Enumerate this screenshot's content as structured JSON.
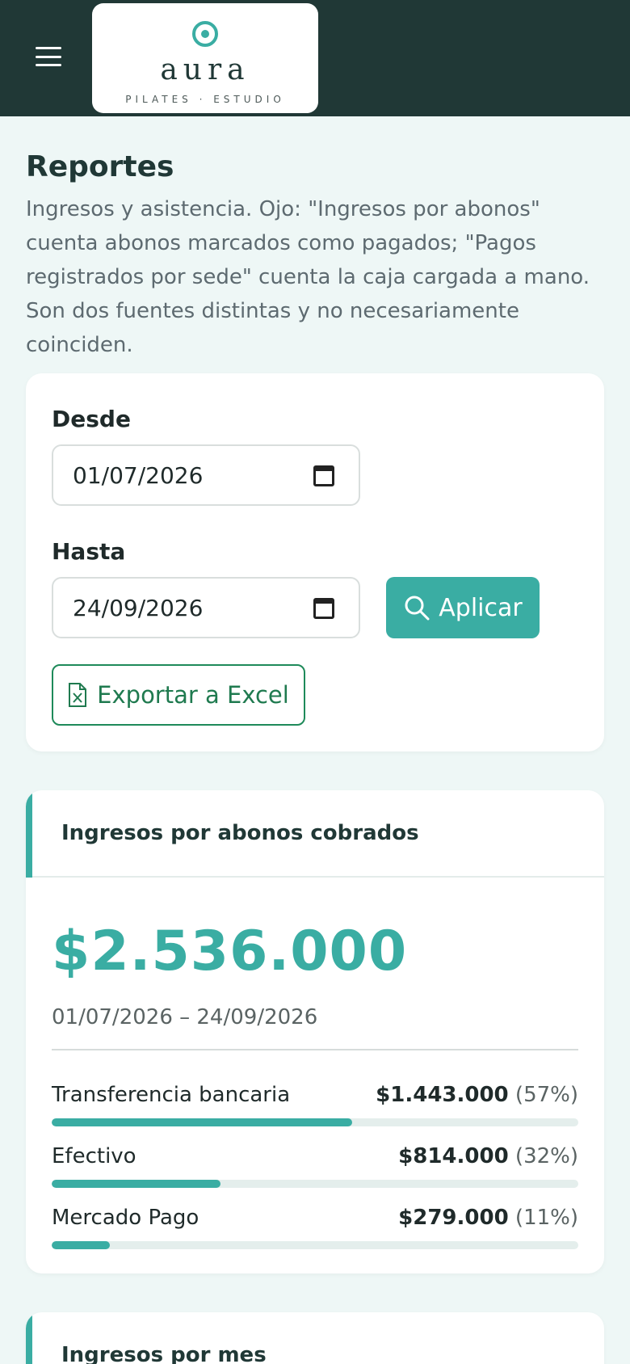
{
  "header": {
    "logo_name": "aura",
    "logo_tagline": "PILATES · ESTUDIO"
  },
  "page": {
    "title": "Reportes",
    "description": "Ingresos y asistencia. Ojo: \"Ingresos por abonos\" cuenta abonos marcados como pagados; \"Pagos registrados por sede\" cuenta la caja cargada a mano. Son dos fuentes distintas y no necesariamente coinciden."
  },
  "filters": {
    "from_label": "Desde",
    "from_value": "01/07/2026",
    "to_label": "Hasta",
    "to_value": "24/09/2026",
    "apply_label": "Aplicar",
    "export_label": "Exportar a Excel"
  },
  "income": {
    "title": "Ingresos por abonos cobrados",
    "total": "$2.536.000",
    "range": "01/07/2026 – 24/09/2026",
    "breakdown": [
      {
        "label": "Transferencia bancaria",
        "amount": "$1.443.000",
        "pct_text": "(57%)",
        "fraction": 0.57
      },
      {
        "label": "Efectivo",
        "amount": "$814.000",
        "pct_text": "(32%)",
        "fraction": 0.32
      },
      {
        "label": "Mercado Pago",
        "amount": "$279.000",
        "pct_text": "(11%)",
        "fraction": 0.11
      }
    ]
  },
  "monthly": {
    "title": "Ingresos por mes"
  },
  "colors": {
    "header_bg": "#203836",
    "accent": "#3aada3",
    "export_green": "#1f7a4f"
  },
  "icons": [
    "menu-icon",
    "logo-mark-icon",
    "calendar-icon",
    "search-icon",
    "excel-file-icon"
  ]
}
